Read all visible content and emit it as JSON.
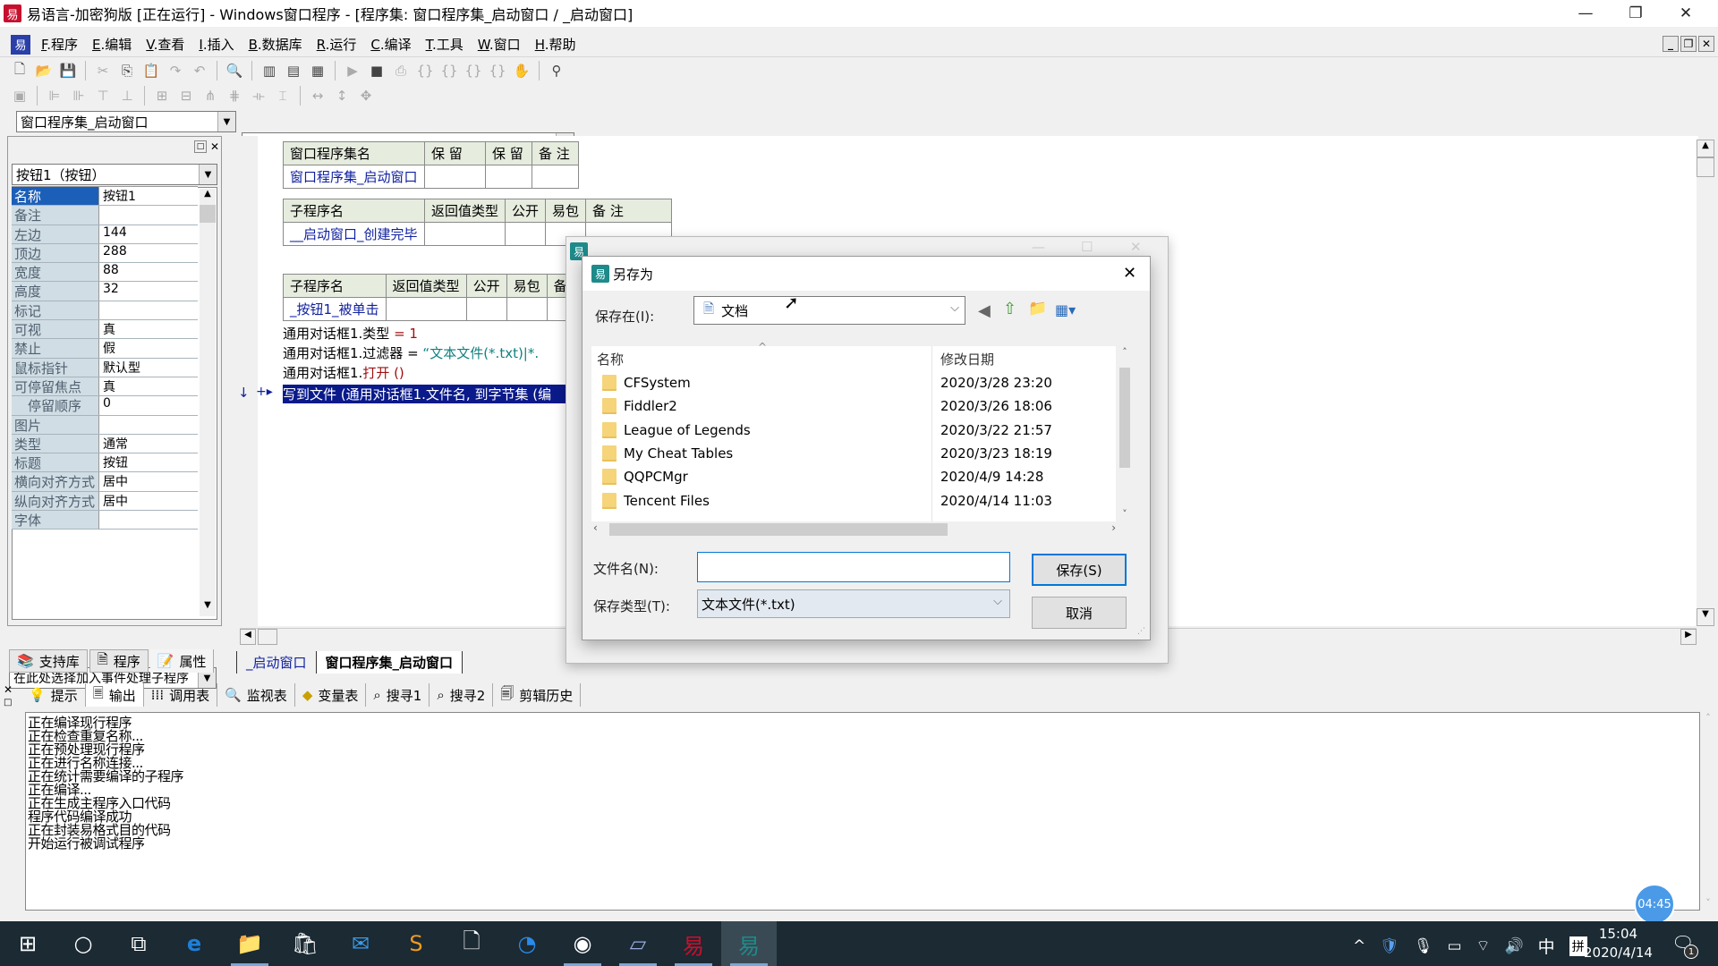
{
  "window": {
    "title": "易语言-加密狗版 [正在运行] - Windows窗口程序 - [程序集: 窗口程序集_启动窗口 / _启动窗口]",
    "app_icon": "易"
  },
  "menu": [
    {
      "key": "F",
      "label": ".程序"
    },
    {
      "key": "E",
      "label": ".编辑"
    },
    {
      "key": "V",
      "label": ".查看"
    },
    {
      "key": "I",
      "label": ".插入"
    },
    {
      "key": "B",
      "label": ".数据库"
    },
    {
      "key": "R",
      "label": ".运行"
    },
    {
      "key": "C",
      "label": ".编译"
    },
    {
      "key": "T",
      "label": ".工具"
    },
    {
      "key": "W",
      "label": ".窗口"
    },
    {
      "key": "H",
      "label": ".帮助"
    }
  ],
  "selectors": {
    "assembly": "窗口程序集_启动窗口",
    "subroutine": "_按钮1_被单击"
  },
  "properties": {
    "object_combo": "按钮1（按钮）",
    "rows": [
      {
        "key": "名称",
        "value": "按钮1",
        "selected": true
      },
      {
        "key": "备注",
        "value": ""
      },
      {
        "key": "左边",
        "value": "144"
      },
      {
        "key": "顶边",
        "value": "288"
      },
      {
        "key": "宽度",
        "value": "88"
      },
      {
        "key": "高度",
        "value": "32"
      },
      {
        "key": "标记",
        "value": ""
      },
      {
        "key": "可视",
        "value": "真"
      },
      {
        "key": "禁止",
        "value": "假"
      },
      {
        "key": "鼠标指针",
        "value": "默认型"
      },
      {
        "key": "可停留焦点",
        "value": "真"
      },
      {
        "key": "　停留顺序",
        "value": "0"
      },
      {
        "key": "图片",
        "value": ""
      },
      {
        "key": "类型",
        "value": "通常"
      },
      {
        "key": "标题",
        "value": "按钮"
      },
      {
        "key": "横向对齐方式",
        "value": "居中"
      },
      {
        "key": "纵向对齐方式",
        "value": "居中"
      },
      {
        "key": "字体",
        "value": ""
      }
    ],
    "event_combo": "在此处选择加入事件处理子程序",
    "tabs": [
      "支持库",
      "程序",
      "属性"
    ]
  },
  "code": {
    "table1": {
      "headers": [
        "窗口程序集名",
        "保 留",
        "保 留",
        "备 注"
      ],
      "row": [
        "窗口程序集_启动窗口",
        "",
        "",
        ""
      ]
    },
    "table2": {
      "headers": [
        "子程序名",
        "返回值类型",
        "公开",
        "易包",
        "备 注"
      ],
      "row": [
        "__启动窗口_创建完毕",
        "",
        "",
        "",
        ""
      ]
    },
    "table3": {
      "headers": [
        "子程序名",
        "返回值类型",
        "公开",
        "易包",
        "备"
      ],
      "row": [
        "_按钮1_被单击",
        "",
        "",
        "",
        ""
      ]
    },
    "lines": [
      {
        "obj": "通用对话框1.类型",
        "op": " = ",
        "val": "1"
      },
      {
        "obj": "通用对话框1.过滤器",
        "op": " = ",
        "val": "“文本文件(*.txt)|*."
      },
      {
        "obj": "通用对话框1.",
        "op": "",
        "val": "打开 ()"
      }
    ],
    "selected_line": "写到文件 (通用对话框1.文件名, 到字节集 (编",
    "tabs": [
      "_启动窗口",
      "窗口程序集_启动窗口"
    ]
  },
  "dialog": {
    "title": "另存为",
    "save_in_label": "保存在(I):",
    "save_in_value": "文档",
    "columns": [
      "名称",
      "修改日期"
    ],
    "files": [
      {
        "name": "CFSystem",
        "date": "2020/3/28 23:20"
      },
      {
        "name": "Fiddler2",
        "date": "2020/3/26 18:06"
      },
      {
        "name": "League of Legends",
        "date": "2020/3/22 21:57"
      },
      {
        "name": "My Cheat Tables",
        "date": "2020/3/23 18:19"
      },
      {
        "name": "QQPCMgr",
        "date": "2020/4/9 14:28"
      },
      {
        "name": "Tencent Files",
        "date": "2020/4/14 11:03"
      }
    ],
    "filename_label": "文件名(N):",
    "filename_value": "",
    "filetype_label": "保存类型(T):",
    "filetype_value": "文本文件(*.txt)",
    "save_button": "保存(S)",
    "cancel_button": "取消"
  },
  "output_tabs": [
    "提示",
    "输出",
    "调用表",
    "监视表",
    "变量表",
    "搜寻1",
    "搜寻2",
    "剪辑历史"
  ],
  "output_lines": [
    "正在编译现行程序",
    "正在检查重复名称...",
    "正在预处理现行程序",
    "正在进行名称连接...",
    "正在统计需要编译的子程序",
    "正在编译...",
    "正在生成主程序入口代码",
    "程序代码编译成功",
    "正在封装易格式目的代码",
    "开始运行被调试程序"
  ],
  "timer_badge": "04:45",
  "taskbar": {
    "time": "15:04",
    "date": "2020/4/14",
    "ime_lang": "中",
    "ime_mode": "拼",
    "notifications": "1"
  }
}
